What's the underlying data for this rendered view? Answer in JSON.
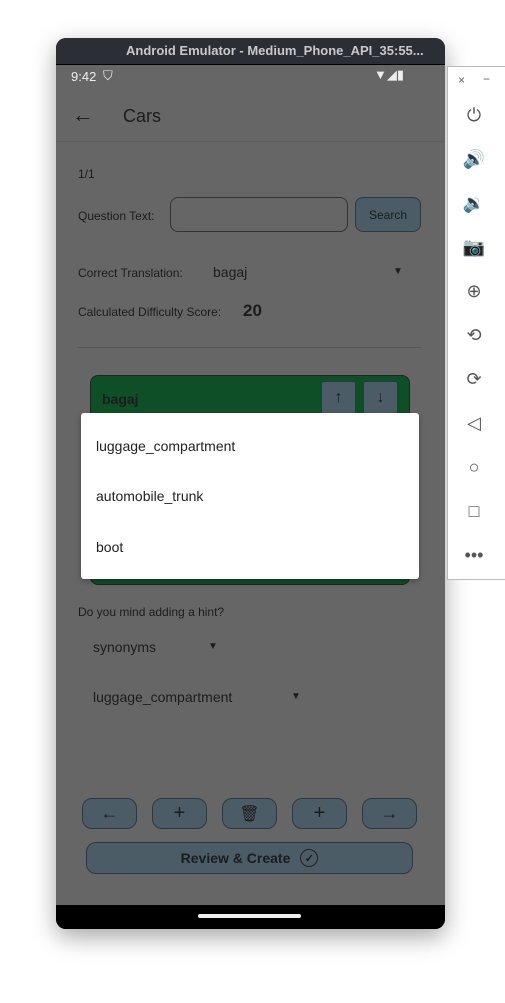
{
  "window": {
    "title": "Android Emulator - Medium_Phone_API_35:55..."
  },
  "status_bar": {
    "time": "9:42"
  },
  "app_bar": {
    "title": "Cars"
  },
  "page": {
    "counter": "1/1",
    "question_label": "Question Text:",
    "question_value": "",
    "search_label": "Search",
    "translation_label": "Correct Translation:",
    "translation_value": "bagaj",
    "difficulty_label": "Calculated Difficulty Score:",
    "difficulty_value": "20",
    "card_title": "bagaj",
    "hint_label": "Do you mind adding a hint?",
    "hint_type": "synonyms",
    "hint_value": "luggage_compartment",
    "review_label": "Review & Create"
  },
  "dropdown_menu": {
    "items": [
      "luggage_compartment",
      "automobile_trunk",
      "boot"
    ]
  },
  "colors": {
    "card": "#0f4f27",
    "button": "#4c5c66",
    "scrim": "#666666"
  }
}
